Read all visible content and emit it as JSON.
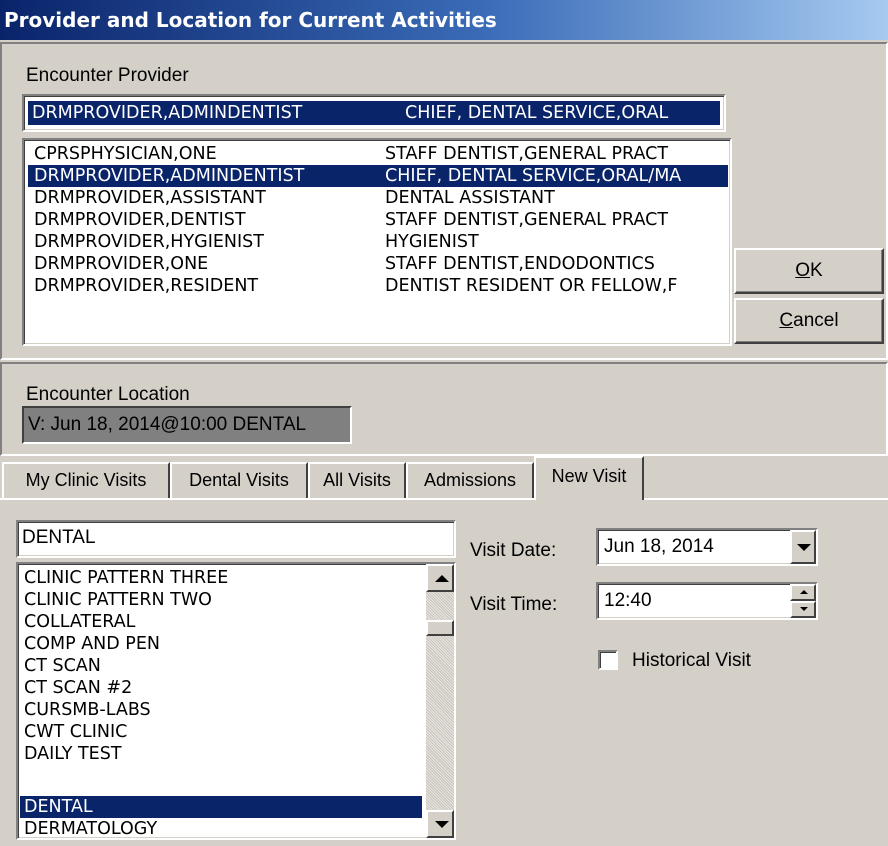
{
  "window": {
    "title": "Provider and Location for Current Activities"
  },
  "provider": {
    "label": "Encounter Provider",
    "selected_name": "DRMPROVIDER,ADMINDENTIST",
    "selected_title": "CHIEF, DENTAL SERVICE,ORAL",
    "items": [
      {
        "name": "CPRSPHYSICIAN,ONE",
        "title": "STAFF DENTIST,GENERAL PRACT"
      },
      {
        "name": "DRMPROVIDER,ADMINDENTIST",
        "title": "CHIEF, DENTAL SERVICE,ORAL/MA"
      },
      {
        "name": "DRMPROVIDER,ASSISTANT",
        "title": "DENTAL ASSISTANT"
      },
      {
        "name": "DRMPROVIDER,DENTIST",
        "title": "STAFF DENTIST,GENERAL PRACT"
      },
      {
        "name": "DRMPROVIDER,HYGIENIST",
        "title": "HYGIENIST"
      },
      {
        "name": "DRMPROVIDER,ONE",
        "title": "STAFF DENTIST,ENDODONTICS"
      },
      {
        "name": "DRMPROVIDER,RESIDENT",
        "title": "DENTIST RESIDENT OR FELLOW,F"
      }
    ]
  },
  "buttons": {
    "ok_accel": "O",
    "ok_rest": "K",
    "cancel_accel": "C",
    "cancel_rest": "ancel"
  },
  "location": {
    "label": "Encounter Location",
    "value": "V: Jun 18, 2014@10:00 DENTAL"
  },
  "tabs": [
    {
      "label": "My Clinic Visits"
    },
    {
      "label": "Dental Visits"
    },
    {
      "label": "All Visits"
    },
    {
      "label": "Admissions"
    },
    {
      "label": "New Visit"
    }
  ],
  "new_visit": {
    "search_value": "DENTAL",
    "clinics": [
      "CLINIC PATTERN THREE",
      "CLINIC PATTERN TWO",
      "COLLATERAL",
      "COMP AND PEN",
      "CT SCAN",
      "CT SCAN #2",
      "CURSMB-LABS",
      "CWT CLINIC",
      "DAILY TEST",
      "DENTAL",
      "DERMATOLOGY"
    ],
    "visit_date_label": "Visit Date:",
    "visit_date": "Jun 18, 2014",
    "visit_time_label": "Visit Time:",
    "visit_time": "12:40",
    "historical_label": "Historical Visit",
    "historical_checked": false
  },
  "colors": {
    "selection": "#0a246a",
    "face": "#d4d0c8",
    "location_bg": "#808080"
  }
}
